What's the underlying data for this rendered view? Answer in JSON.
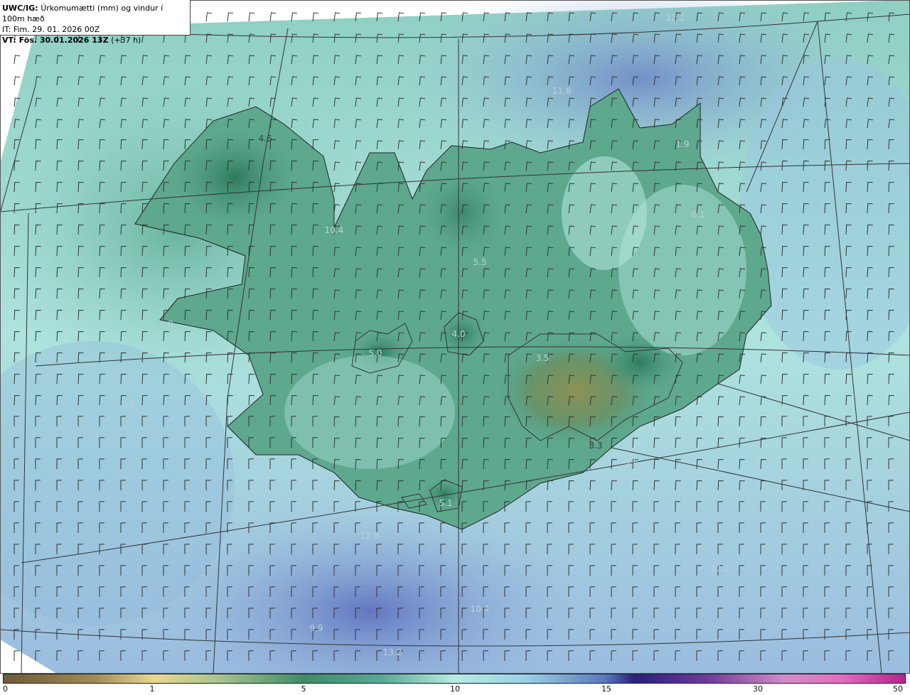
{
  "header": {
    "model": "UWC/IG:",
    "title": "Úrkomumætti (mm) og vindur í 100m hæð",
    "init_label": "IT:",
    "init_time": "Fim. 29. 01. 2026 00Z",
    "valid_label": "VT:",
    "valid_time": "Fös. 30.01.2026 13Z",
    "lead": "(+37 h)"
  },
  "colorbar": {
    "ticks": [
      "0",
      "1",
      "5",
      "10",
      "15",
      "30",
      "50"
    ],
    "colors": [
      "#6d5a3a",
      "#e8d890",
      "#3f8a6a",
      "#b8ebe0",
      "#5a78bf",
      "#2a1f7d",
      "#d48cc9",
      "#b4238f"
    ]
  },
  "value_labels": [
    {
      "text": "12.2",
      "faint": true
    },
    {
      "text": "11.8",
      "faint": true
    },
    {
      "text": "4.6",
      "faint": false
    },
    {
      "text": "1.9",
      "faint": true
    },
    {
      "text": "6.1",
      "faint": true
    },
    {
      "text": "10.4",
      "faint": true
    },
    {
      "text": "5.5",
      "faint": true
    },
    {
      "text": "8",
      "faint": true
    },
    {
      "text": "4.0",
      "faint": true
    },
    {
      "text": "5.0",
      "faint": true
    },
    {
      "text": "3.5",
      "faint": true
    },
    {
      "text": "9.2",
      "faint": true
    },
    {
      "text": "3.3",
      "faint": false
    },
    {
      "text": "5.6",
      "faint": true
    },
    {
      "text": "7.8",
      "faint": true
    },
    {
      "text": "5.1",
      "faint": true
    },
    {
      "text": "12.8",
      "faint": true
    },
    {
      "text": "10.2",
      "faint": true
    },
    {
      "text": "10.4",
      "faint": true
    },
    {
      "text": "9.9",
      "faint": true
    },
    {
      "text": "13.2",
      "faint": true
    }
  ],
  "map_colors": {
    "sea_mid": "#b5e6e0",
    "sea_blue": "#7e9bd3",
    "land_green": "#4f9d82",
    "land_dark": "#2e7a5c",
    "land_brown": "#8a8e55",
    "coast": "#222222",
    "barb": "#333333"
  }
}
